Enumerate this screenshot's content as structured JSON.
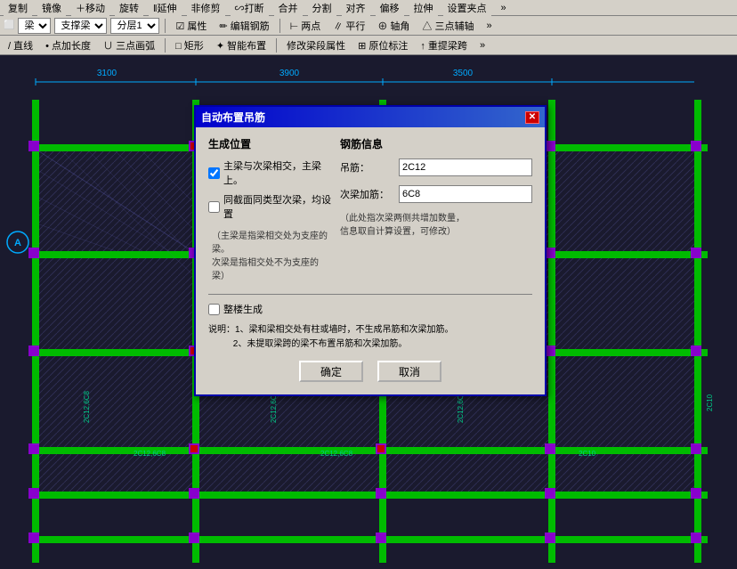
{
  "toolbar": {
    "row1": {
      "items": [
        "复制",
        "镜像",
        "移动",
        "旋转",
        "延伸",
        "修剪",
        "打断",
        "合并",
        "分割",
        "对齐",
        "偏移",
        "拉伸",
        "设置夹点"
      ]
    },
    "row2": {
      "beam_label": "梁",
      "support_label": "支撑梁",
      "layer_label": "分层1",
      "attr_btn": "属性",
      "edit_rebar_btn": "编辑钢筋",
      "two_point_btn": "两点",
      "parallel_btn": "平行",
      "axis_btn": "轴角",
      "three_aux_btn": "三点辅轴"
    },
    "row3": {
      "line_btn": "直线",
      "point_grow_btn": "点加长度",
      "three_arc_btn": "三点画弧",
      "rect_btn": "矩形",
      "smart_layout_btn": "智能布置",
      "modify_prop_btn": "修改梁段属性",
      "origin_mark_btn": "原位标注",
      "lift_beam_btn": "重提梁跨"
    }
  },
  "dimensions": {
    "top": [
      "3100",
      "3900",
      "3500"
    ]
  },
  "dialog": {
    "title": "自动布置吊筋",
    "sections": {
      "left_title": "生成位置",
      "right_title": "钢筋信息"
    },
    "checkbox1_label": "主梁与次梁相交，主梁上。",
    "checkbox1_checked": true,
    "checkbox2_label": "同截面同类型次梁，均设置",
    "checkbox2_checked": false,
    "note1": "（主梁是指梁相交处为支座的梁。\n次梁是指相交处不为支座的梁）",
    "whole_floor_label": "整楼生成",
    "whole_floor_checked": false,
    "notes": "说明：1、梁和梁相交处有柱或墙时，不生成吊筋和次梁加筋。\n          2、未提取梁跨的梁不布置吊筋和次梁加筋。",
    "hanging_rebar_label": "吊筋：",
    "hanging_rebar_value": "2C12",
    "sub_beam_rebar_label": "次梁加筋：",
    "sub_beam_rebar_value": "6C8",
    "rebar_note": "（此处指次梁两侧共增加数量，\n信息取自计算设置，可修改）",
    "ok_button": "确定",
    "cancel_button": "取消"
  },
  "beam_labels": {
    "items": [
      "2C12,6C8",
      "2C12,6C8",
      "2C12,6C8",
      "2C12,6C8",
      "2C10"
    ]
  }
}
